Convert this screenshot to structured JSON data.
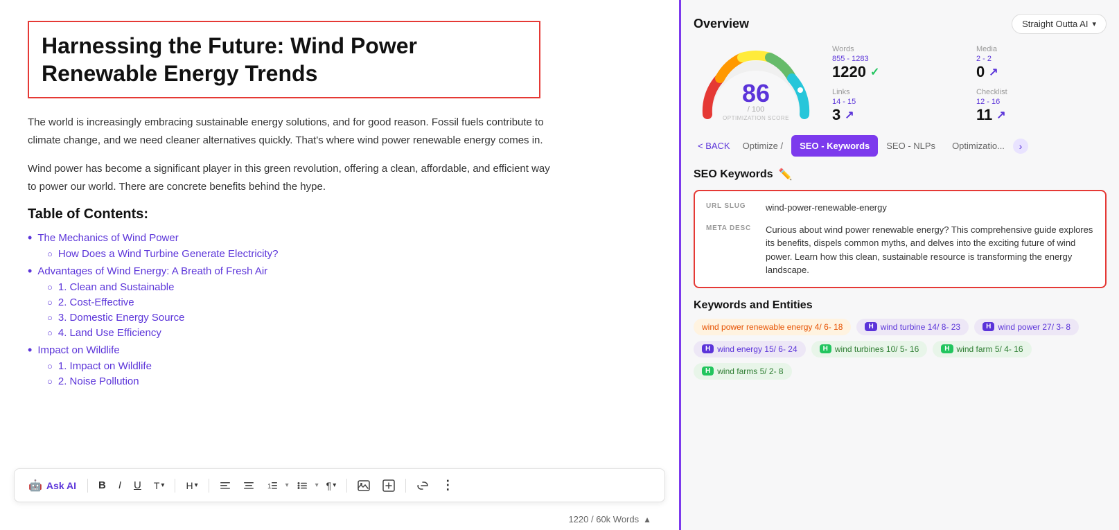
{
  "editor": {
    "title": "Harnessing the Future: Wind Power Renewable Energy Trends",
    "intro1": "The world is increasingly embracing sustainable energy solutions, and for good reason. Fossil fuels contribute to climate change, and we need cleaner alternatives quickly. That's where wind power renewable energy comes in.",
    "intro2": "Wind power has become a significant player in this green revolution, offering a clean, affordable, and efficient way to power our world. There are concrete benefits behind the hype.",
    "toc_heading": "Table of Contents:",
    "toc_items": [
      {
        "label": "The Mechanics of Wind Power",
        "sub": [
          "How Does a Wind Turbine Generate Electricity?"
        ]
      },
      {
        "label": "Advantages of Wind Energy: A Breath of Fresh Air",
        "sub": [
          "1. Clean and Sustainable",
          "2. Cost-Effective",
          "3. Domestic Energy Source",
          "4. Land Use Efficiency"
        ]
      },
      {
        "label": "Impact on Wildlife",
        "sub": [
          "1. Impact on Wildlife",
          "2. Noise Pollution"
        ]
      }
    ],
    "word_count": "1220 / 60k Words"
  },
  "toolbar": {
    "ask_ai": "Ask AI",
    "bold": "B",
    "italic": "I",
    "underline": "U",
    "text_t": "T",
    "heading_h": "H",
    "align_left": "≡",
    "align_center": "≡",
    "list_ol": "≡",
    "list_ul": "≡",
    "paragraph": "¶",
    "image": "🖼",
    "add": "⊕",
    "link": "🔗",
    "more": "⋮"
  },
  "right": {
    "overview_title": "Overview",
    "template_label": "Straight Outta AI",
    "score": {
      "value": "86",
      "denom": "/ 100",
      "label": "OPTIMIZATION SCORE"
    },
    "stats": {
      "words_label": "Words",
      "words_range": "855 - 1283",
      "words_value": "1220",
      "media_label": "Media",
      "media_range": "2 - 2",
      "media_value": "0",
      "links_label": "Links",
      "links_range": "14 - 15",
      "links_value": "3",
      "checklist_label": "Checklist",
      "checklist_range": "12 - 16",
      "checklist_value": "11"
    },
    "tabs": {
      "back": "< BACK",
      "optimize": "Optimize /",
      "seo_keywords": "SEO - Keywords",
      "seo_nlps": "SEO - NLPs",
      "optimization": "Optimizatio..."
    },
    "seo_keywords_title": "SEO Keywords",
    "seo_box": {
      "url_slug_label": "URL SLUG",
      "url_slug_value": "wind-power-renewable-energy",
      "meta_desc_label": "META DESC",
      "meta_desc_value": "Curious about wind power renewable energy? This comprehensive guide explores its benefits, dispels common myths, and delves into the exciting future of wind power. Learn how this clean, sustainable resource is transforming the energy landscape."
    },
    "keywords_section_title": "Keywords and Entities",
    "keywords": [
      {
        "label": "wind power renewable energy 4/ 6- 18",
        "type": "orange",
        "badge": null
      },
      {
        "label": "wind turbine 14/ 8- 23",
        "type": "purple",
        "badge": "H"
      },
      {
        "label": "wind power 27/ 3- 8",
        "type": "purple",
        "badge": "H"
      },
      {
        "label": "wind energy 15/ 6- 24",
        "type": "purple",
        "badge": "H"
      },
      {
        "label": "wind turbines 10/ 5- 16",
        "type": "green",
        "badge": "H"
      },
      {
        "label": "wind farm 5/ 4- 16",
        "type": "green",
        "badge": "H"
      },
      {
        "label": "wind farms 5/ 2- 8",
        "type": "green",
        "badge": "H"
      }
    ]
  }
}
